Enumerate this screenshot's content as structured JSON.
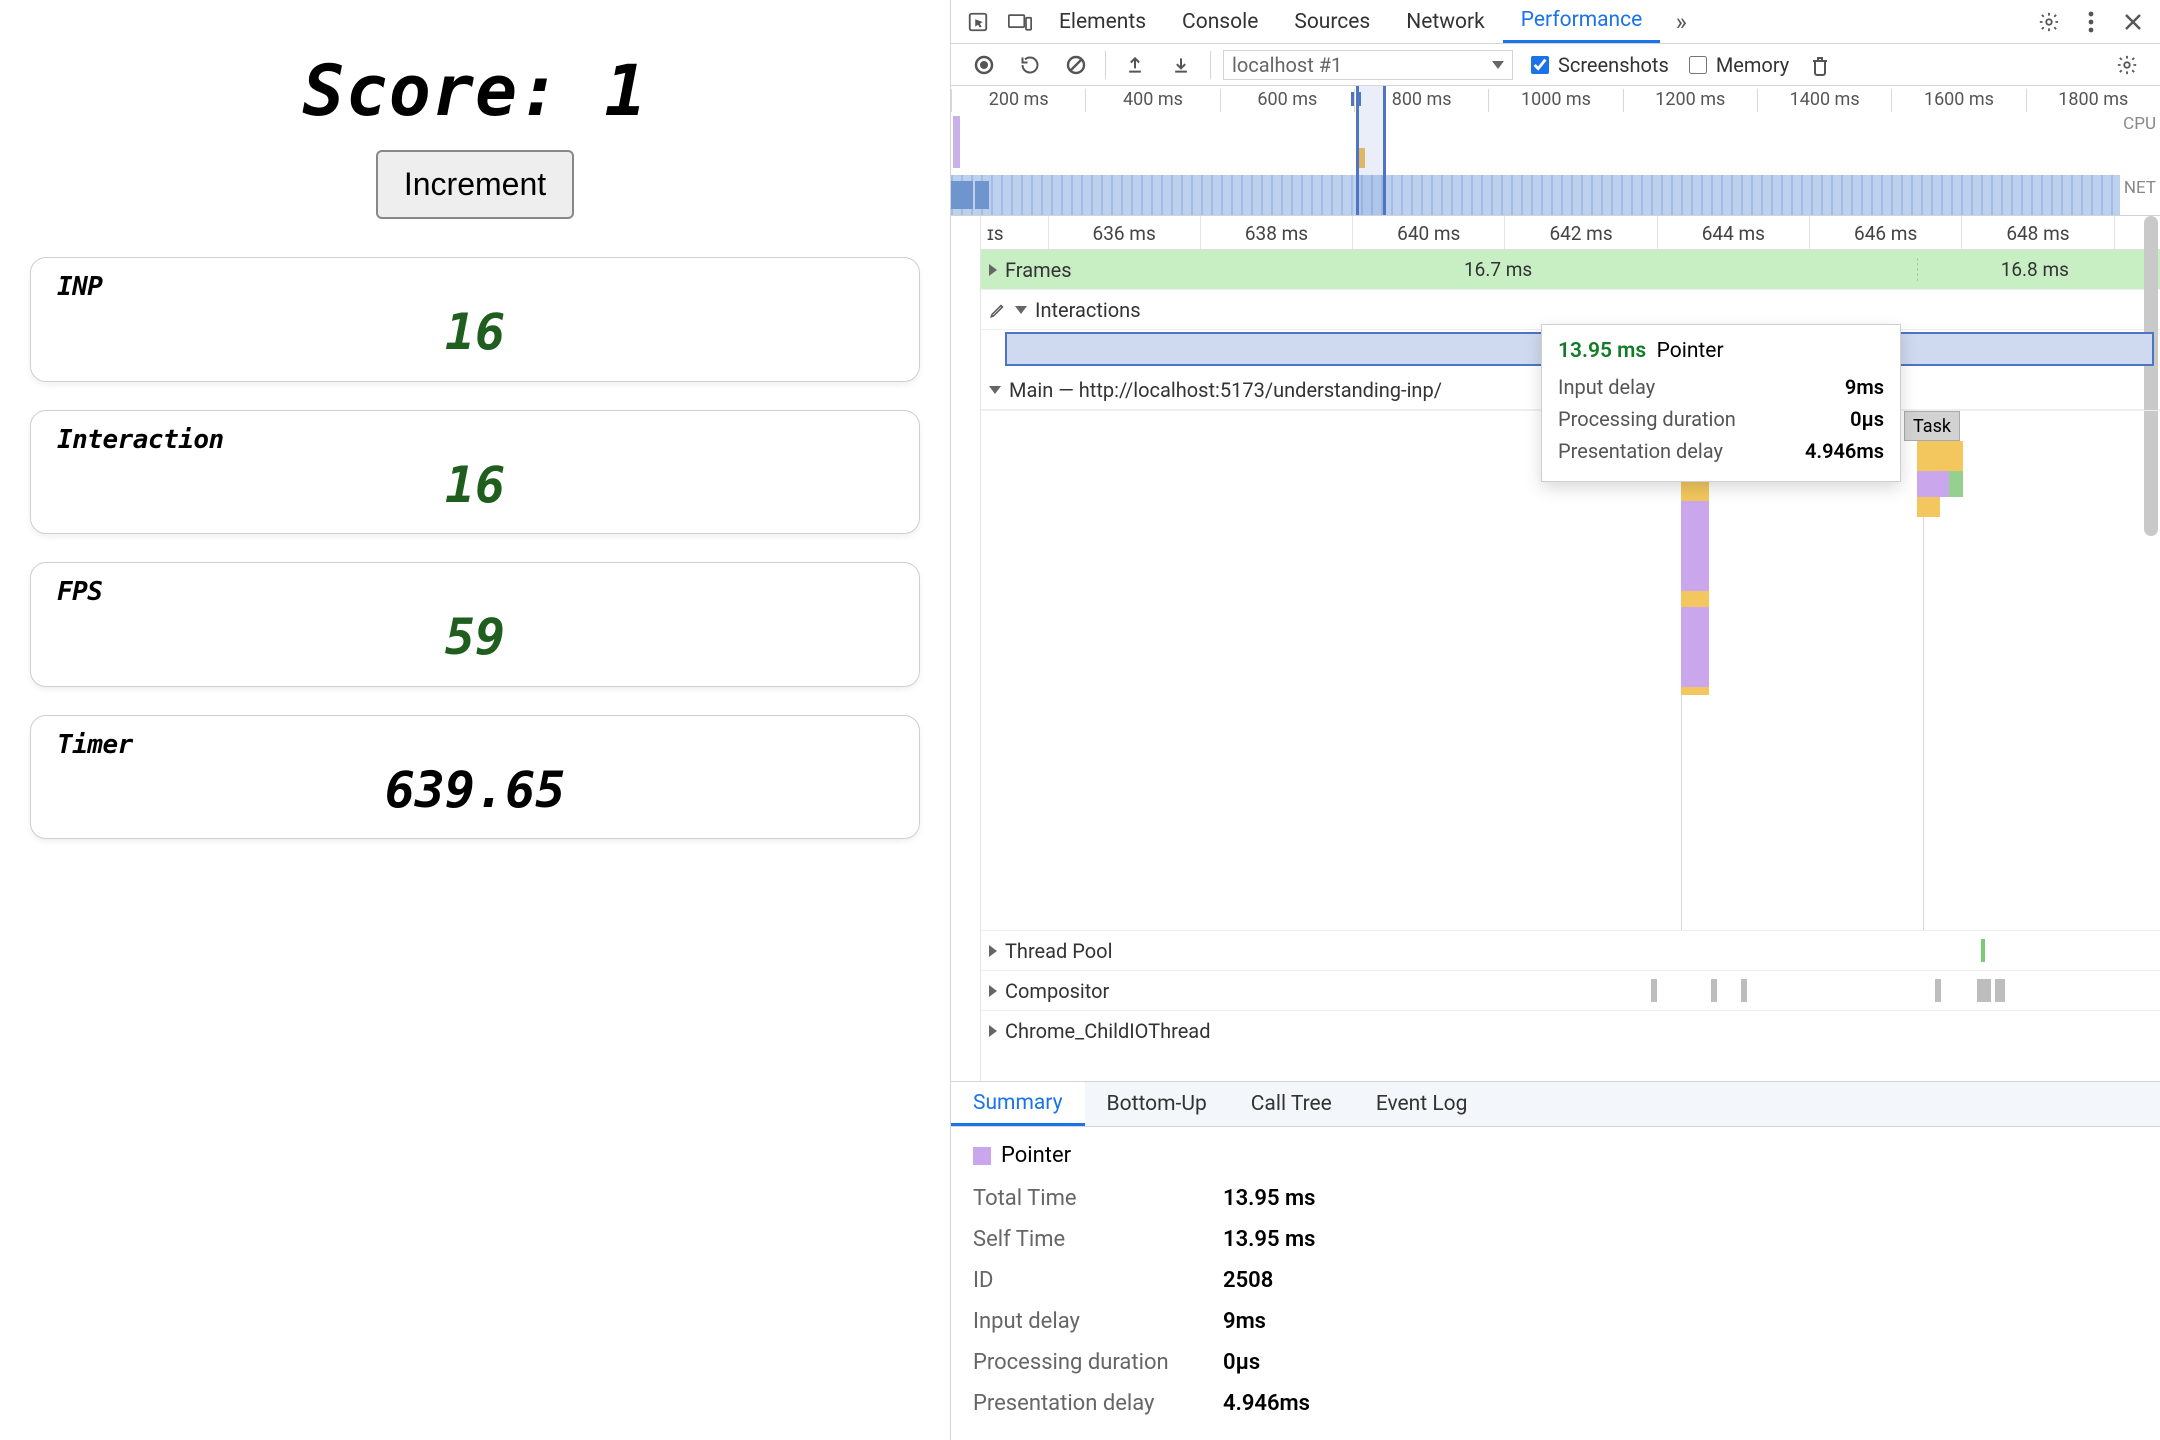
{
  "app": {
    "title": "Score: 1",
    "button": "Increment",
    "cards": {
      "inp": {
        "label": "INP",
        "value": "16"
      },
      "interaction": {
        "label": "Interaction",
        "value": "16"
      },
      "fps": {
        "label": "FPS",
        "value": "59"
      },
      "timer": {
        "label": "Timer",
        "value": "639.65"
      }
    }
  },
  "devtools": {
    "tabs": [
      "Elements",
      "Console",
      "Sources",
      "Network",
      "Performance"
    ],
    "activeTab": "Performance",
    "toolbar": {
      "recording_select": "localhost #1",
      "screenshots_label": "Screenshots",
      "memory_label": "Memory",
      "screenshots_checked": true,
      "memory_checked": false
    },
    "overview_ticks": [
      "200 ms",
      "400 ms",
      "600 ms",
      "800 ms",
      "1000 ms",
      "1200 ms",
      "1400 ms",
      "1600 ms",
      "1800 ms"
    ],
    "overview_lanes": {
      "cpu": "CPU",
      "net": "NET"
    },
    "zoom_ticks": [
      "636 ms",
      "638 ms",
      "640 ms",
      "642 ms",
      "644 ms",
      "646 ms",
      "648 ms"
    ],
    "rows": {
      "frames": "Frames",
      "frame_times": [
        "16.7 ms",
        "16.8 ms"
      ],
      "interactions": "Interactions",
      "main": "Main — http://localhost:5173/understanding-inp/",
      "task": "Task",
      "thread_pool": "Thread Pool",
      "compositor": "Compositor",
      "chrome_io": "Chrome_ChildIOThread"
    },
    "tooltip": {
      "time": "13.95 ms",
      "type": "Pointer",
      "input_delay_label": "Input delay",
      "input_delay": "9ms",
      "processing_label": "Processing duration",
      "processing": "0µs",
      "presentation_label": "Presentation delay",
      "presentation": "4.946ms"
    },
    "summary_tabs": [
      "Summary",
      "Bottom-Up",
      "Call Tree",
      "Event Log"
    ],
    "summary_active": "Summary",
    "summary": {
      "type": "Pointer",
      "total_time_label": "Total Time",
      "total_time": "13.95 ms",
      "self_time_label": "Self Time",
      "self_time": "13.95 ms",
      "id_label": "ID",
      "id": "2508",
      "input_delay_label": "Input delay",
      "input_delay": "9ms",
      "processing_label": "Processing duration",
      "processing": "0µs",
      "presentation_label": "Presentation delay",
      "presentation": "4.946ms"
    }
  }
}
